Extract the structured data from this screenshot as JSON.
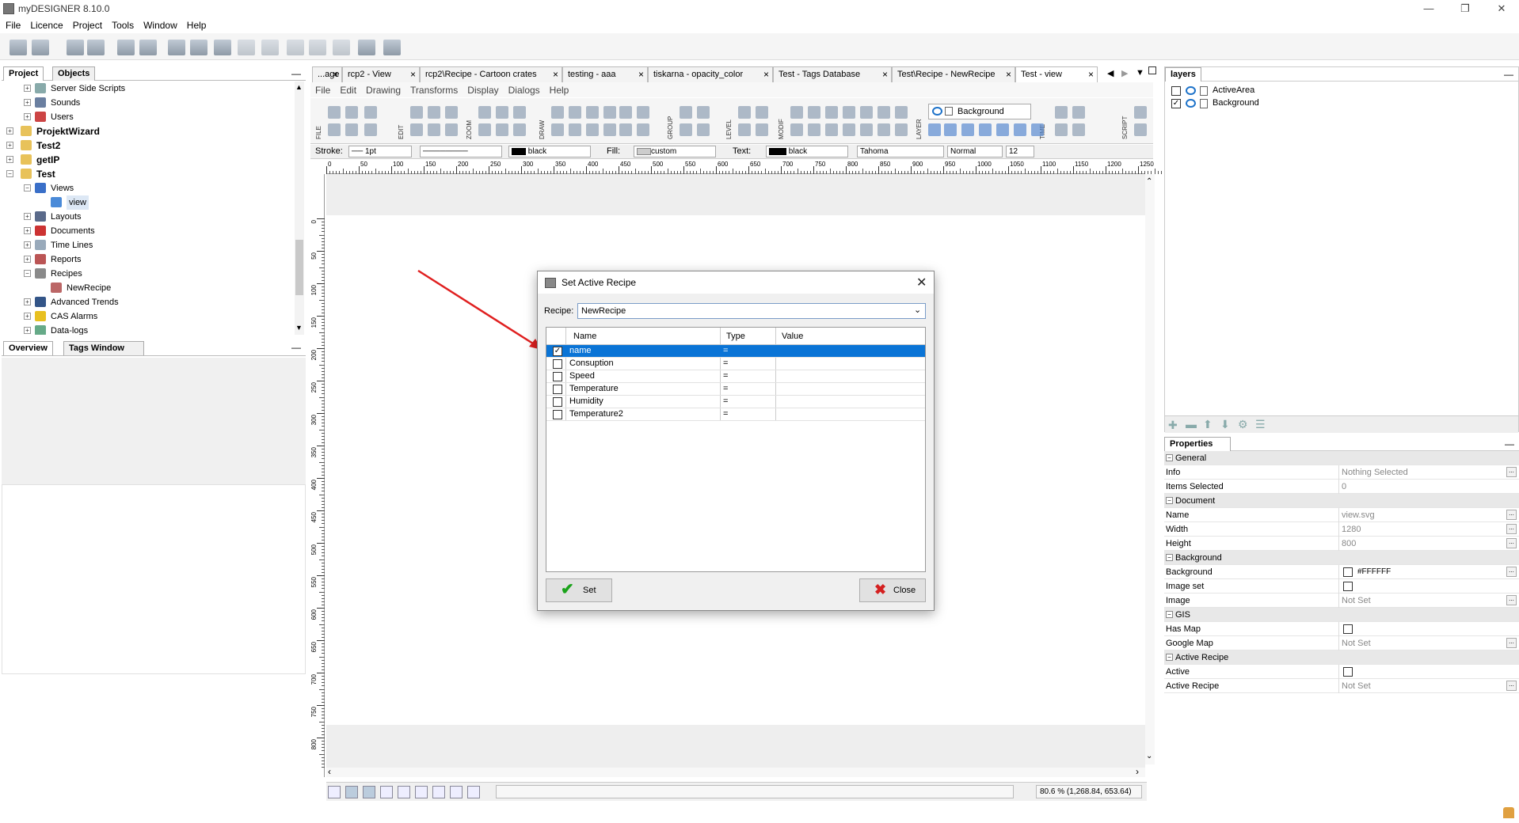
{
  "app": {
    "title": "myDESIGNER 8.10.0"
  },
  "menu": [
    "File",
    "Licence",
    "Project",
    "Tools",
    "Window",
    "Help"
  ],
  "left_panel": {
    "tabs": [
      "Project",
      "Objects"
    ],
    "tree": [
      {
        "label": "Server Side Scripts",
        "level": 2,
        "bold": false,
        "icon": "script-icon"
      },
      {
        "label": "Sounds",
        "level": 2,
        "bold": false,
        "icon": "speaker-icon"
      },
      {
        "label": "Users",
        "level": 2,
        "bold": false,
        "icon": "users-icon"
      },
      {
        "label": "ProjektWizard",
        "level": 0,
        "bold": true,
        "icon": "folder-icon"
      },
      {
        "label": "Test2",
        "level": 0,
        "bold": true,
        "icon": "folder-icon"
      },
      {
        "label": "getIP",
        "level": 0,
        "bold": true,
        "icon": "folder-icon"
      },
      {
        "label": "Test",
        "level": 0,
        "bold": true,
        "icon": "folder-open-icon"
      },
      {
        "label": "Views",
        "level": 2,
        "bold": false,
        "icon": "views-icon"
      },
      {
        "label": "view",
        "level": 3,
        "bold": false,
        "icon": "view-icon"
      },
      {
        "label": "Layouts",
        "level": 2,
        "bold": false,
        "icon": "layouts-icon"
      },
      {
        "label": "Documents",
        "level": 2,
        "bold": false,
        "icon": "documents-icon"
      },
      {
        "label": "Time Lines",
        "level": 2,
        "bold": false,
        "icon": "timeline-icon"
      },
      {
        "label": "Reports",
        "level": 2,
        "bold": false,
        "icon": "reports-icon"
      },
      {
        "label": "Recipes",
        "level": 2,
        "bold": false,
        "icon": "recipes-icon"
      },
      {
        "label": "NewRecipe",
        "level": 3,
        "bold": false,
        "icon": "recipe-icon"
      },
      {
        "label": "Advanced Trends",
        "level": 2,
        "bold": false,
        "icon": "trends-icon"
      },
      {
        "label": "CAS Alarms",
        "level": 2,
        "bold": false,
        "icon": "alarm-icon"
      },
      {
        "label": "Data-logs",
        "level": 2,
        "bold": false,
        "icon": "datalog-icon"
      }
    ],
    "bottom_tabs": [
      "Overview",
      "Tags Window"
    ]
  },
  "doc_tabs": [
    "...age",
    "rcp2 - View",
    "rcp2\\Recipe - Cartoon crates",
    "testing - aaa",
    "tiskarna - opacity_color",
    "Test - Tags Database",
    "Test\\Recipe - NewRecipe",
    "Test - view"
  ],
  "doc_submenu": [
    "File",
    "Edit",
    "Drawing",
    "Transforms",
    "Display",
    "Dialogs",
    "Help"
  ],
  "draw_groups": [
    "FILE",
    "EDIT",
    "ZOOM",
    "DRAW",
    "GROUP",
    "LEVEL",
    "MODIF",
    "LAYER",
    "TIME",
    "SCRIPT"
  ],
  "layer_select": "Background",
  "stylebar": {
    "stroke_label": "Stroke:",
    "stroke_width": "1pt",
    "stroke_color": "black",
    "fill_label": "Fill:",
    "fill_value": "custom",
    "text_label": "Text:",
    "text_color": "black",
    "font": "Tahoma",
    "weight": "Normal",
    "size": "12"
  },
  "ruler_h": [
    "0",
    "50",
    "100",
    "150",
    "200",
    "250",
    "300",
    "350",
    "400",
    "450",
    "500",
    "550",
    "600",
    "650",
    "700",
    "750",
    "800",
    "850",
    "900",
    "950",
    "1000",
    "1050",
    "1100",
    "1150",
    "1200",
    "1250"
  ],
  "ruler_v": [
    "0",
    "50",
    "100",
    "150",
    "200",
    "250",
    "300",
    "350",
    "400",
    "450",
    "500",
    "550",
    "600",
    "650",
    "700",
    "750",
    "800"
  ],
  "status": {
    "zoom": "80.6 % (1,268.84, 653.64)"
  },
  "dialog": {
    "title": "Set Active Recipe",
    "recipe_label": "Recipe:",
    "recipe_value": "NewRecipe",
    "columns": [
      "Name",
      "Type",
      "Value"
    ],
    "rows": [
      {
        "checked": true,
        "name": "name",
        "type": "=",
        "value": ""
      },
      {
        "checked": false,
        "name": "Consuption",
        "type": "=",
        "value": ""
      },
      {
        "checked": false,
        "name": "Speed",
        "type": "=",
        "value": ""
      },
      {
        "checked": false,
        "name": "Temperature",
        "type": "=",
        "value": ""
      },
      {
        "checked": false,
        "name": "Humidity",
        "type": "=",
        "value": ""
      },
      {
        "checked": false,
        "name": "Temperature2",
        "type": "=",
        "value": ""
      }
    ],
    "set_label": "Set",
    "close_label": "Close"
  },
  "layers": {
    "title": "layers",
    "items": [
      {
        "name": "ActiveArea",
        "checked": false
      },
      {
        "name": "Background",
        "checked": true
      }
    ]
  },
  "properties": {
    "title": "Properties",
    "rows": [
      {
        "section": true,
        "label": "General"
      },
      {
        "label": "Info",
        "value": "Nothing Selected",
        "dots": true
      },
      {
        "label": "Items Selected",
        "value": "0"
      },
      {
        "section": true,
        "label": "Document"
      },
      {
        "label": "Name",
        "value": "view.svg",
        "dots": true
      },
      {
        "label": "Width",
        "value": "1280",
        "dots": true
      },
      {
        "label": "Height",
        "value": "800",
        "dots": true
      },
      {
        "section": true,
        "label": "Background"
      },
      {
        "label": "Background",
        "value": "#FFFFFF",
        "color": true,
        "dots": true
      },
      {
        "label": "Image set",
        "checkbox": true
      },
      {
        "label": "Image",
        "value": "Not Set",
        "dots": true
      },
      {
        "section": true,
        "label": "GIS"
      },
      {
        "label": "Has Map",
        "checkbox": true
      },
      {
        "label": "Google Map",
        "value": "Not Set",
        "dots": true
      },
      {
        "section": true,
        "label": "Active Recipe"
      },
      {
        "label": "Active",
        "checkbox": true
      },
      {
        "label": "Active Recipe",
        "value": "Not Set",
        "dots": true
      }
    ]
  },
  "colors": {
    "selection": "#0a74d6",
    "arrow": "#e02020",
    "set_check": "#1aa31a",
    "close_x": "#d42020"
  }
}
